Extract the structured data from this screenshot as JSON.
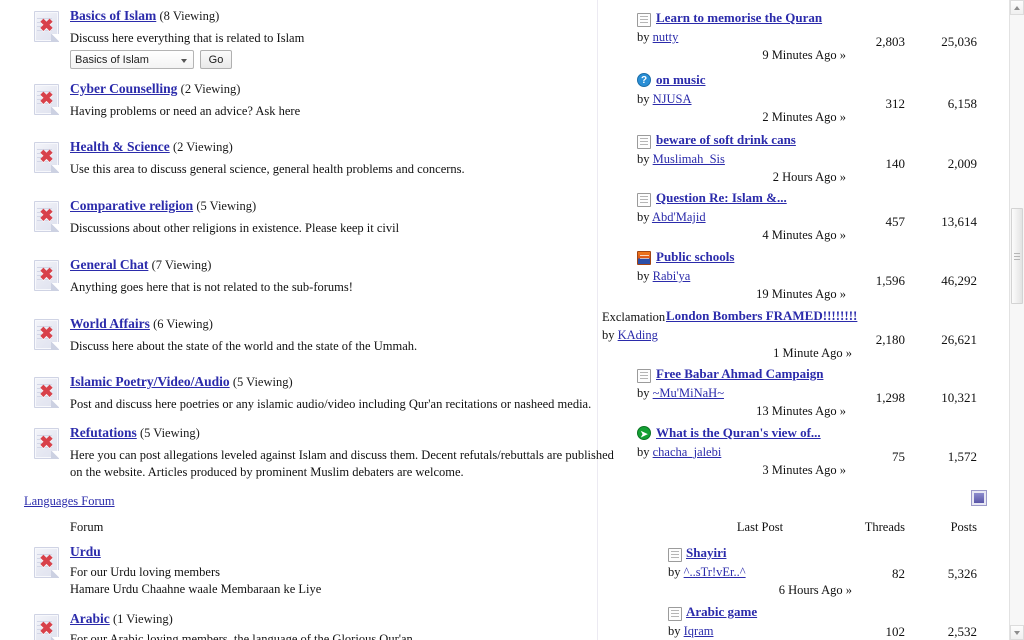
{
  "forums": [
    {
      "title": "Basics of Islam",
      "viewing": "(8 Viewing)",
      "desc": "Discuss here everything that is related to Islam",
      "jump": {
        "value": "Basics of Islam",
        "go_label": "Go"
      }
    },
    {
      "title": "Cyber Counselling",
      "viewing": "(2 Viewing)",
      "desc": "Having problems or need an advice? Ask here"
    },
    {
      "title": "Health & Science",
      "viewing": "(2 Viewing)",
      "desc": "Use this area to discuss general science, general health problems and concerns."
    },
    {
      "title": "Comparative religion",
      "viewing": "(5 Viewing)",
      "desc": "Discussions about other religions in existence. Please keep it civil"
    },
    {
      "title": "General Chat",
      "viewing": "(7 Viewing)",
      "desc": "Anything goes here that is not related to the sub-forums!"
    },
    {
      "title": "World Affairs",
      "viewing": "(6 Viewing)",
      "desc": "Discuss here about the state of the world and the state of the Ummah."
    },
    {
      "title": "Islamic Poetry/Video/Audio",
      "viewing": "(5 Viewing)",
      "desc": "Post and discuss here poetries or any islamic audio/video including Qur'an recitations or nasheed media."
    },
    {
      "title": "Refutations",
      "viewing": "(5 Viewing)",
      "desc": "Here you can post allegations leveled against Islam and discuss them. Decent refutals/rebuttals are published",
      "desc2": "on the website. Articles produced by prominent Muslim debaters are welcome."
    }
  ],
  "lastposts": [
    {
      "icon": "doc-icon",
      "prefix": "",
      "title": "Learn to memorise the Quran",
      "by_label": "by",
      "author": "nutty",
      "time": "9 Minutes Ago »",
      "threads": "2,803",
      "posts": "25,036"
    },
    {
      "icon": "question-icon",
      "prefix": "",
      "title": "on music",
      "by_label": "by",
      "author": "NJUSA",
      "time": "2 Minutes Ago »",
      "threads": "312",
      "posts": "6,158"
    },
    {
      "icon": "doc-icon",
      "prefix": "",
      "title": "beware of soft drink cans",
      "by_label": "by",
      "author": "Muslimah_Sis",
      "time": "2 Hours Ago »",
      "threads": "140",
      "posts": "2,009"
    },
    {
      "icon": "doc-icon",
      "prefix": "",
      "title": "Question Re: Islam &...",
      "by_label": "by",
      "author": "Abd'Majid",
      "time": "4 Minutes Ago »",
      "threads": "457",
      "posts": "13,614"
    },
    {
      "icon": "poll-icon",
      "prefix": "",
      "title": "Public schools",
      "by_label": "by",
      "author": "Rabi'ya",
      "time": "19 Minutes Ago »",
      "threads": "1,596",
      "posts": "46,292"
    },
    {
      "icon": "none",
      "prefix": "Exclamation",
      "title": "London Bombers FRAMED!!!!!!!!",
      "by_label": "by",
      "author": "KAding",
      "time": "1 Minute Ago »",
      "threads": "2,180",
      "posts": "26,621"
    },
    {
      "icon": "doc-icon",
      "prefix": "",
      "title": "Free Babar Ahmad Campaign",
      "by_label": "by",
      "author": "~Mu'MiNaH~",
      "time": "13 Minutes Ago »",
      "threads": "1,298",
      "posts": "10,321"
    },
    {
      "icon": "arrow-icon",
      "prefix": "",
      "title": "What is the Quran's view of...",
      "by_label": "by",
      "author": "chacha_jalebi",
      "time": "3 Minutes Ago »",
      "threads": "75",
      "posts": "1,572"
    }
  ],
  "languages_section": {
    "header_link": "Languages Forum",
    "columns": {
      "forum": "Forum",
      "last_post": "Last Post",
      "threads": "Threads",
      "posts": "Posts"
    },
    "forums": [
      {
        "title": "Urdu",
        "viewing": "",
        "desc": "For our Urdu loving members",
        "desc2": "Hamare Urdu Chaahne waale Membaraan ke Liye"
      },
      {
        "title": "Arabic",
        "viewing": "(1 Viewing)",
        "desc": "For our Arabic loving members, the language of the Glorious Qur'an"
      }
    ],
    "lastposts": [
      {
        "icon": "doc-icon",
        "title": "Shayiri",
        "by_label": "by",
        "author": "^..sTr!vEr..^",
        "time": "6 Hours Ago »",
        "threads": "82",
        "posts": "5,326"
      },
      {
        "icon": "doc-icon",
        "title": "Arabic game",
        "by_label": "by",
        "author": "Iqram",
        "time": "",
        "threads": "102",
        "posts": "2,532"
      }
    ]
  },
  "colors": {
    "link": "#2b2bab",
    "text": "#111111",
    "collapse_button": "#5a56a8"
  }
}
